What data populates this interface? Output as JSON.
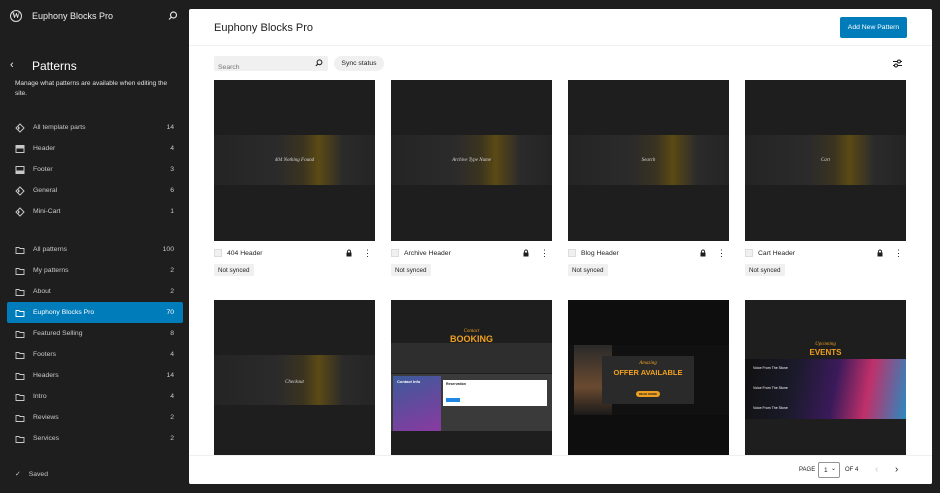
{
  "site": {
    "title": "Euphony Blocks Pro"
  },
  "sidebar": {
    "heading": "Patterns",
    "description": "Manage what patterns are available when editing the site.",
    "template_parts": [
      {
        "label": "All template parts",
        "count": "14",
        "icon": "template-parts-icon"
      },
      {
        "label": "Header",
        "count": "4",
        "icon": "header-icon"
      },
      {
        "label": "Footer",
        "count": "3",
        "icon": "footer-icon"
      },
      {
        "label": "General",
        "count": "6",
        "icon": "template-parts-icon"
      },
      {
        "label": "Mini-Cart",
        "count": "1",
        "icon": "template-parts-icon"
      }
    ],
    "categories": [
      {
        "label": "All patterns",
        "count": "100"
      },
      {
        "label": "My patterns",
        "count": "2"
      },
      {
        "label": "About",
        "count": "2"
      },
      {
        "label": "Euphony Blocks Pro",
        "count": "70",
        "active": true
      },
      {
        "label": "Featured Selling",
        "count": "8"
      },
      {
        "label": "Footers",
        "count": "4"
      },
      {
        "label": "Headers",
        "count": "14"
      },
      {
        "label": "Intro",
        "count": "4"
      },
      {
        "label": "Reviews",
        "count": "2"
      },
      {
        "label": "Services",
        "count": "2"
      }
    ],
    "saved_label": "Saved"
  },
  "main": {
    "title": "Euphony Blocks Pro",
    "add_button": "Add New Pattern",
    "search_placeholder": "Search",
    "sync_status": "Sync status",
    "patterns": [
      {
        "name": "404 Header",
        "status": "Not synced",
        "thumb_text": "404 Nothing Found"
      },
      {
        "name": "Archive Header",
        "status": "Not synced",
        "thumb_text": "Archive Type Name"
      },
      {
        "name": "Blog Header",
        "status": "Not synced",
        "thumb_text": "Search"
      },
      {
        "name": "Cart Header",
        "status": "Not synced",
        "thumb_text": "Cart"
      }
    ],
    "row2_thumbs": {
      "checkout": "Checkout",
      "booking_sub": "Contact",
      "booking_title": "BOOKING",
      "contact_info": "Contact Info",
      "reservation": "Reservation",
      "offer_sub": "Amazing",
      "offer_title": "OFFER AVAILABLE",
      "offer_btn": "READ MORE",
      "events_sub": "Upcoming",
      "events_title": "EVENTS",
      "event_item": "Voice From The Stone"
    },
    "pagination": {
      "page_label": "PAGE",
      "current": "1",
      "of_label": "OF 4"
    }
  }
}
